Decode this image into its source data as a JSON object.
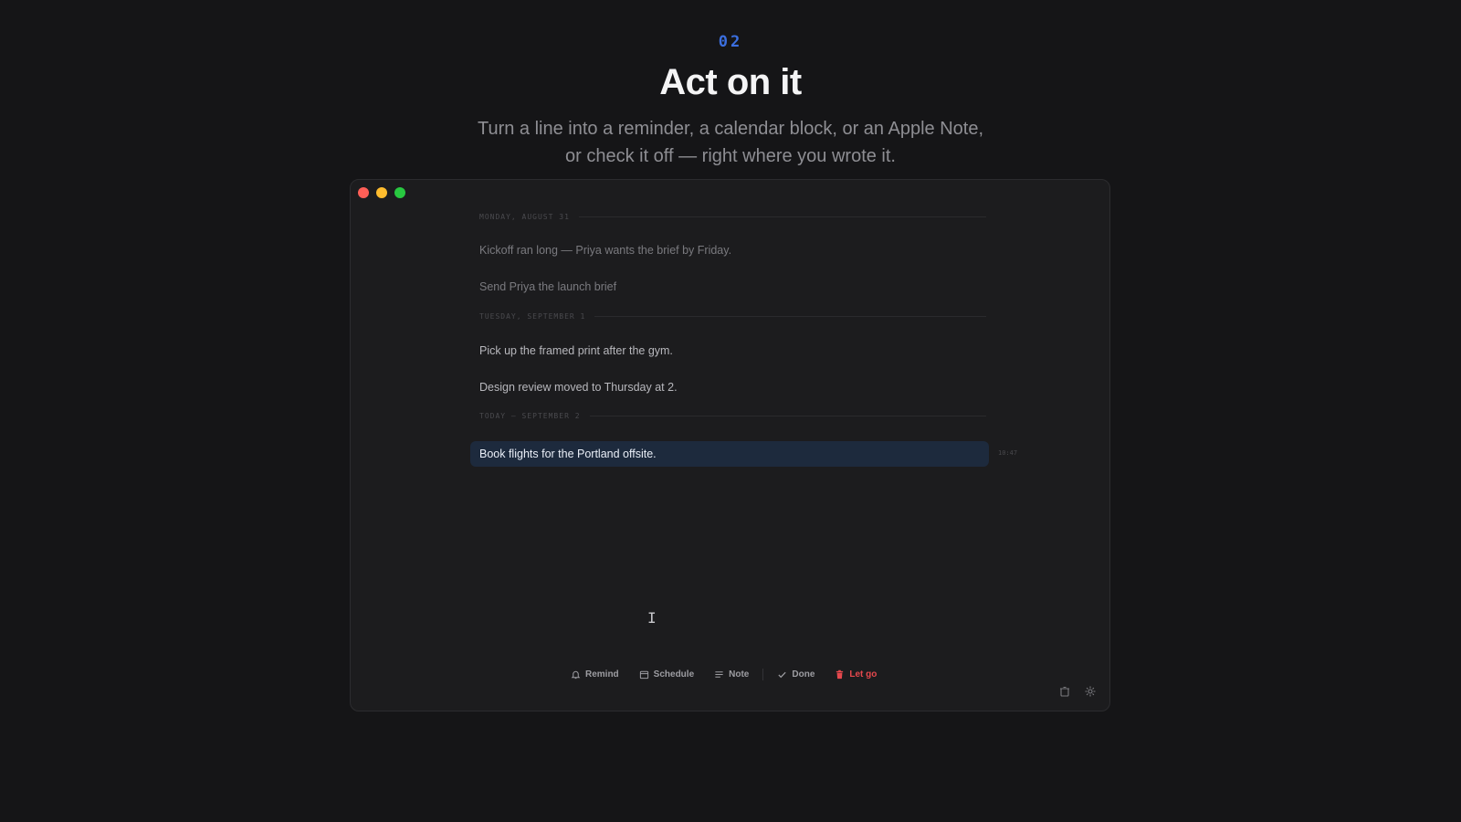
{
  "hero": {
    "step": "02",
    "title": "Act on it",
    "subtitle_line1": "Turn a line into a reminder, a calendar block, or an Apple Note,",
    "subtitle_line2": "or check it off — right where you wrote it."
  },
  "journal": {
    "days": [
      {
        "header": "MONDAY, AUGUST 31",
        "entries": [
          "Kickoff ran long — Priya wants the brief by Friday.",
          "Send Priya the launch brief"
        ]
      },
      {
        "header": "TUESDAY, SEPTEMBER 1",
        "entries": [
          "Pick up the framed print after the gym.",
          "Design review moved to Thursday at 2."
        ]
      },
      {
        "header": "TODAY — SEPTEMBER 2",
        "entries": [
          "Book flights for the Portland offsite."
        ]
      }
    ],
    "selected_timestamp": "10:47"
  },
  "actions": {
    "remind": "Remind",
    "schedule": "Schedule",
    "note": "Note",
    "done": "Done",
    "let_go": "Let go"
  },
  "colors": {
    "accent": "#3b6fe0",
    "danger": "#e5484d",
    "selection": "#1d2a3d"
  }
}
